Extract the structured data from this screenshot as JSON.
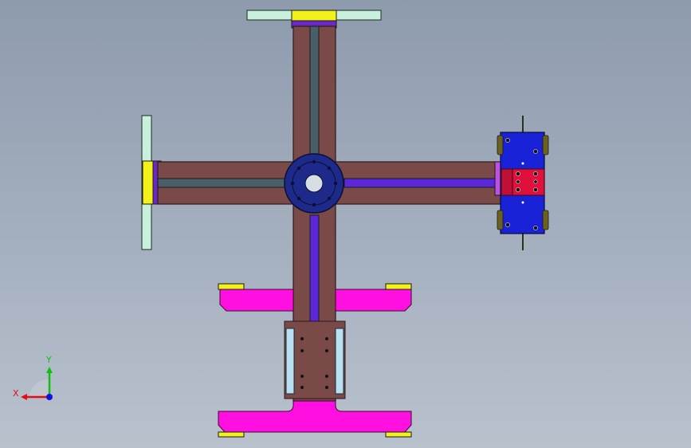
{
  "viewport": {
    "background_top": "#8e9bad",
    "background_bottom": "#b9c1cd"
  },
  "colors": {
    "arm_body": "#7a4a48",
    "arm_outline": "#2b1a1a",
    "rail_slate": "#4a5e6a",
    "rail_violet": "#5a28d8",
    "hub": "#1e2a8a",
    "magenta_base": "#ff10e0",
    "yellow_pad": "#f2f21a",
    "mint_plate": "#c8f0dc",
    "blue_clamp": "#1a22d8",
    "red_block": "#e0103c",
    "light_blue_block": "#b8e0f0",
    "axis_x": "#e01010",
    "axis_y": "#10c010",
    "axis_z": "#1010e0"
  },
  "triad": {
    "x_label": "X",
    "y_label": "Y"
  }
}
